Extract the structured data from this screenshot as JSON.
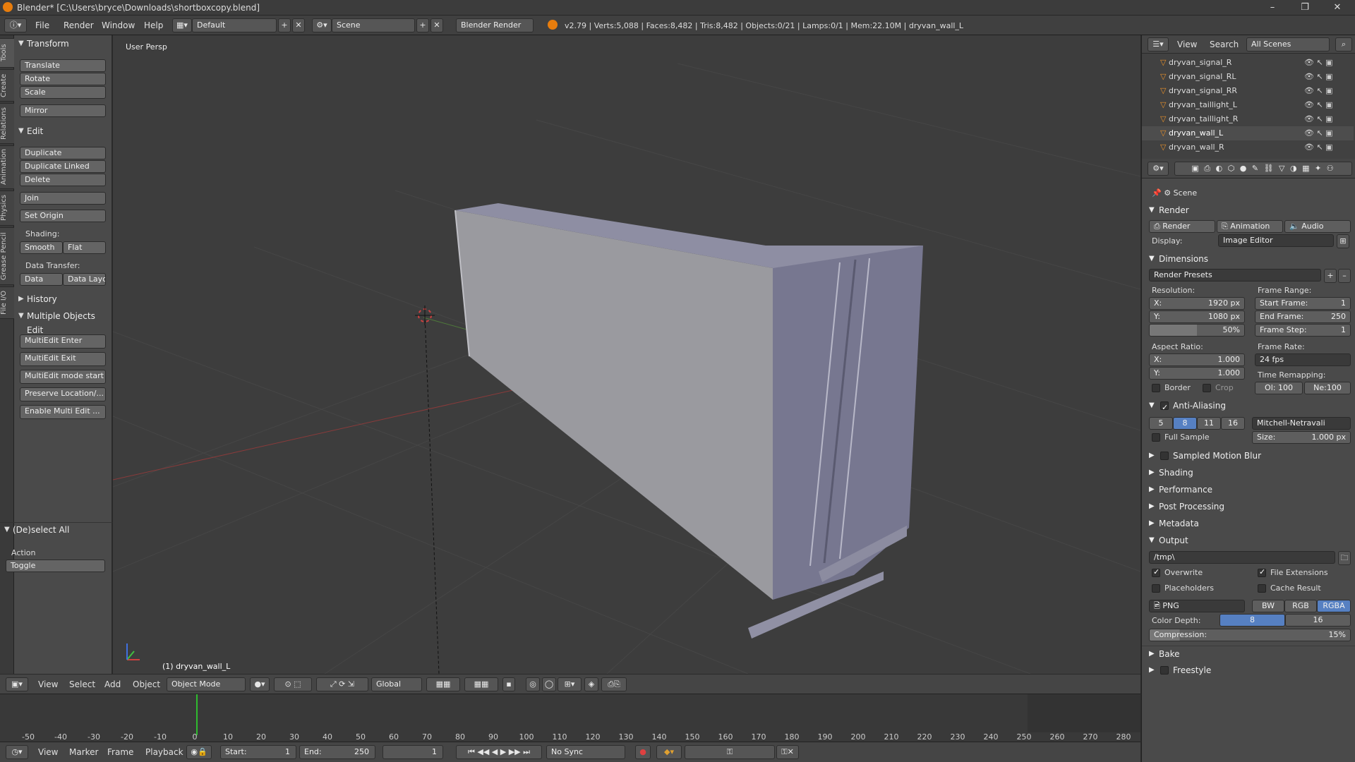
{
  "titlebar": {
    "title": "Blender* [C:\\Users\\bryce\\Downloads\\shortboxcopy.blend]",
    "min": "–",
    "max": "❐",
    "close": "✕"
  },
  "infobar": {
    "menus": [
      "File",
      "Render",
      "Window",
      "Help"
    ],
    "layout": "Default",
    "scene": "Scene",
    "engine": "Blender Render",
    "stats": "v2.79 | Verts:5,088 | Faces:8,482 | Tris:8,482 | Objects:0/21 | Lamps:0/1 | Mem:22.10M | dryvan_wall_L"
  },
  "vtabs": [
    "Tools",
    "Create",
    "Relations",
    "Animation",
    "Physics",
    "Grease Pencil",
    "File I/O"
  ],
  "toolshelf": {
    "transform": {
      "title": "Transform",
      "buttons": [
        "Translate",
        "Rotate",
        "Scale",
        "Mirror"
      ]
    },
    "edit": {
      "title": "Edit",
      "buttons": [
        "Duplicate",
        "Duplicate Linked",
        "Delete",
        "Join",
        "Set Origin"
      ],
      "shading_label": "Shading:",
      "smooth": "Smooth",
      "flat": "Flat",
      "datatransfer_label": "Data Transfer:",
      "data": "Data",
      "datalayo": "Data Layo"
    },
    "history": {
      "title": "History"
    },
    "multi": {
      "title": "Multiple Objects Edit",
      "buttons": [
        "MultiEdit Enter",
        "MultiEdit Exit",
        "MultiEdit mode start",
        "Preserve Location/...",
        "Enable Multi Edit ..."
      ]
    },
    "deselect": {
      "title": "(De)select All",
      "action_label": "Action",
      "action_value": "Toggle"
    }
  },
  "viewport": {
    "label": "User Persp",
    "object_label": "(1) dryvan_wall_L"
  },
  "vphead": {
    "menus": [
      "View",
      "Select",
      "Add",
      "Object"
    ],
    "mode": "Object Mode",
    "orientation": "Global"
  },
  "timeline": {
    "ticks": [
      "-50",
      "-40",
      "-30",
      "-20",
      "-10",
      "0",
      "10",
      "20",
      "30",
      "40",
      "50",
      "60",
      "70",
      "80",
      "90",
      "100",
      "110",
      "120",
      "130",
      "140",
      "150",
      "160",
      "170",
      "180",
      "190",
      "200",
      "210",
      "220",
      "230",
      "240",
      "250",
      "260",
      "270",
      "280"
    ],
    "menus": [
      "View",
      "Marker",
      "Frame",
      "Playback"
    ],
    "start": "Start:",
    "start_val": "1",
    "end": "End:",
    "end_val": "250",
    "current": "1",
    "sync": "No Sync"
  },
  "outliner": {
    "menus": [
      "View",
      "Search"
    ],
    "filter": "All Scenes",
    "items": [
      "dryvan_signal_R",
      "dryvan_signal_RL",
      "dryvan_signal_RR",
      "dryvan_taillight_L",
      "dryvan_taillight_R",
      "dryvan_wall_L",
      "dryvan_wall_R"
    ]
  },
  "props": {
    "scene": "Scene",
    "render": {
      "title": "Render",
      "render_btn": "Render",
      "anim_btn": "Animation",
      "audio_btn": "Audio",
      "display_label": "Display:",
      "display_val": "Image Editor"
    },
    "dimensions": {
      "title": "Dimensions",
      "presets": "Render Presets",
      "res_label": "Resolution:",
      "res_x_lbl": "X:",
      "res_x": "1920 px",
      "res_y_lbl": "Y:",
      "res_y": "1080 px",
      "res_pct": "50%",
      "fr_label": "Frame Range:",
      "start_lbl": "Start Frame:",
      "start": "1",
      "end_lbl": "End Frame:",
      "end": "250",
      "step_lbl": "Frame Step:",
      "step": "1",
      "aspect_label": "Aspect Ratio:",
      "ax_lbl": "X:",
      "ax": "1.000",
      "ay_lbl": "Y:",
      "ay": "1.000",
      "rate_label": "Frame Rate:",
      "rate": "24 fps",
      "remap_label": "Time Remapping:",
      "old": "Ol: 100",
      "new": "Ne:100",
      "border": "Border",
      "crop": "Crop"
    },
    "aa": {
      "title": "Anti-Aliasing",
      "samples": [
        "5",
        "8",
        "11",
        "16"
      ],
      "filter": "Mitchell-Netravali",
      "full_sample": "Full Sample",
      "size": "Size:",
      "size_val": "1.000 px"
    },
    "collapsed": [
      "Sampled Motion Blur",
      "Shading",
      "Performance",
      "Post Processing",
      "Metadata"
    ],
    "output": {
      "title": "Output",
      "path": "/tmp\\",
      "overwrite": "Overwrite",
      "file_ext": "File Extensions",
      "placeholders": "Placeholders",
      "cache": "Cache Result",
      "format": "PNG",
      "bw": "BW",
      "rgb": "RGB",
      "rgba": "RGBA",
      "depth_label": "Color Depth:",
      "d8": "8",
      "d16": "16",
      "compression": "Compression:",
      "comp_val": "15%"
    },
    "bake": "Bake",
    "freestyle": "Freestyle"
  }
}
